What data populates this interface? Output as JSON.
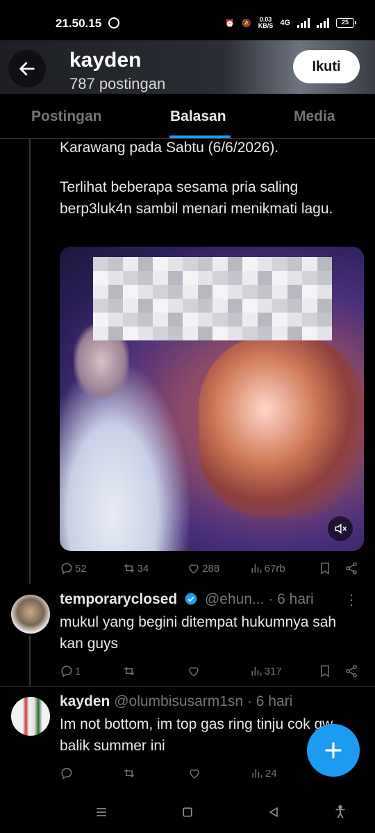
{
  "status_bar": {
    "time": "21.50.15",
    "net_speed_top": "0.03",
    "net_speed_bottom": "KB/S",
    "network": "4G",
    "battery": "25"
  },
  "header": {
    "profile_name": "kayden",
    "post_count": "787 postingan",
    "follow_label": "Ikuti"
  },
  "tabs": [
    {
      "label": "Postingan",
      "active": false
    },
    {
      "label": "Balasan",
      "active": true
    },
    {
      "label": "Media",
      "active": false
    }
  ],
  "main_post": {
    "text_line1": "Karawang pada Sabtu (6/6/2026).",
    "text_para2": "Terlihat beberapa sesama pria saling berp3luk4n sambil menari menikmati lagu.",
    "stats": {
      "replies": "52",
      "reposts": "34",
      "likes": "288",
      "views": "67rb"
    }
  },
  "replies": [
    {
      "name": "temporaryclosed",
      "handle": "@ehun...",
      "time": "· 6 hari",
      "verified": true,
      "text": "mukul yang begini ditempat hukumnya sah kan guys",
      "stats": {
        "replies": "1",
        "reposts": "",
        "likes": "",
        "views": "317"
      }
    },
    {
      "name": "kayden",
      "handle": "@olumbisusarm1sn",
      "time": "· 6 hari",
      "verified": false,
      "text": "Im not bottom, im top gas ring tinju cok gw balik summer ini",
      "stats": {
        "replies": "",
        "reposts": "",
        "likes": "",
        "views": "24"
      }
    }
  ],
  "colors": {
    "accent": "#1d9bf0",
    "background": "#000000",
    "text_primary": "#e7e9ea",
    "text_secondary": "#71767b"
  }
}
